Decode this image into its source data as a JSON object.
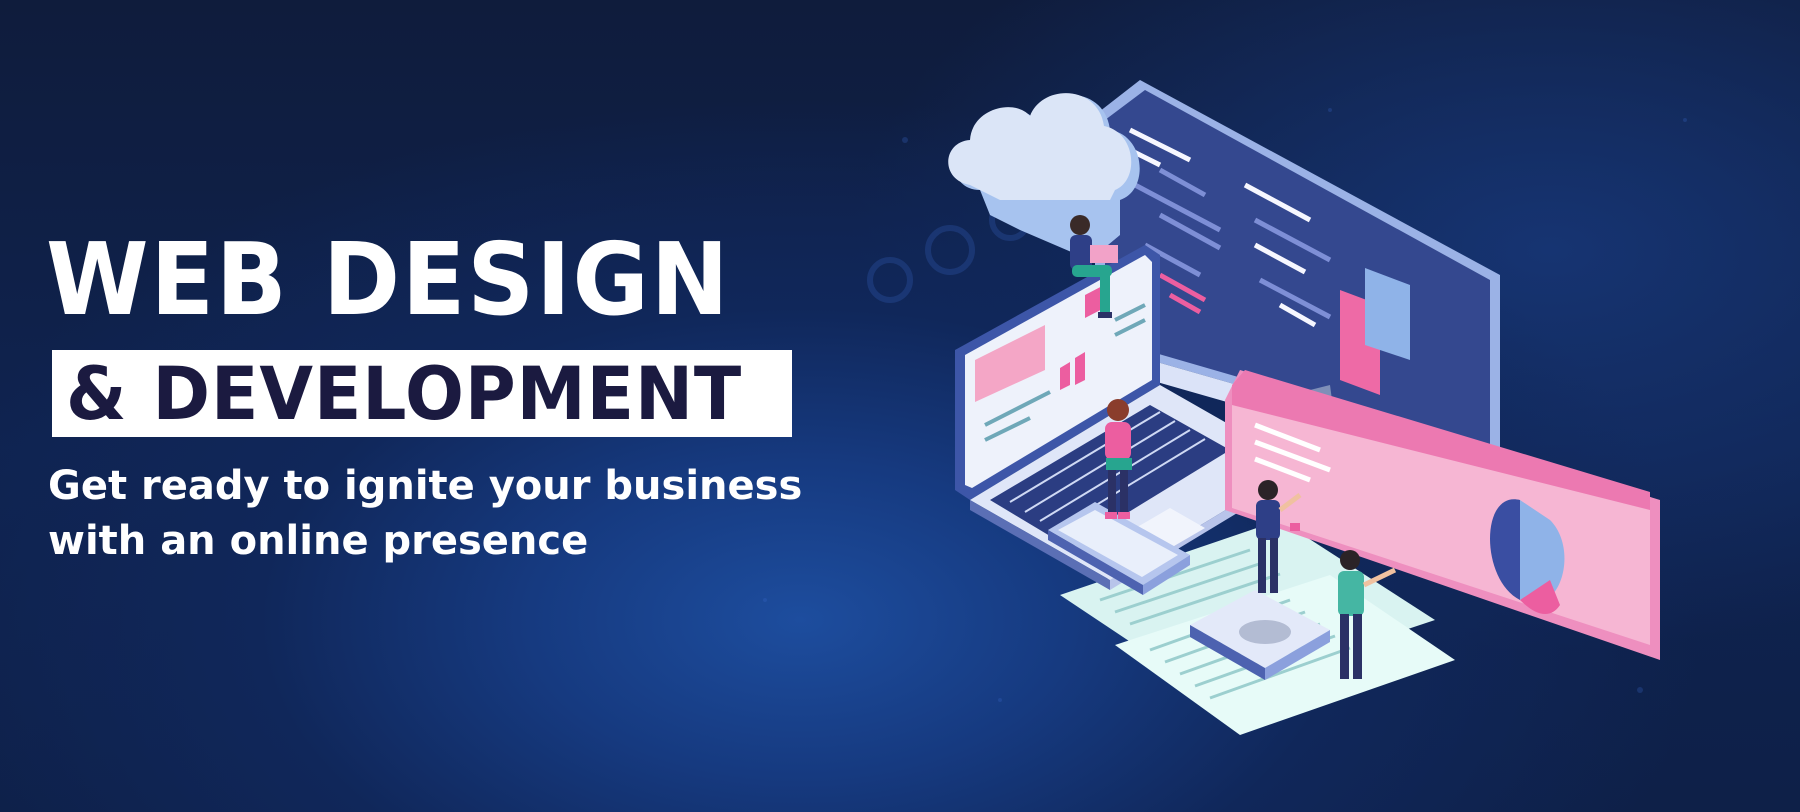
{
  "banner": {
    "title": "WEB DESIGN",
    "subtitle": "& DEVELOPMENT",
    "tagline_line1": "Get ready to ignite your business",
    "tagline_line2": "with an online presence"
  },
  "colors": {
    "background": "#0f2350",
    "accent_pink": "#ee6aa6",
    "screen_blue": "#2f3f8c",
    "title_text": "#ffffff",
    "subtitle_text": "#1b1a40"
  },
  "illustration": {
    "elements": [
      "cloud-icon",
      "desktop-monitor",
      "laptop",
      "smartphone",
      "tablet-platform",
      "document-sheets",
      "chart-panel",
      "person-figures"
    ]
  }
}
